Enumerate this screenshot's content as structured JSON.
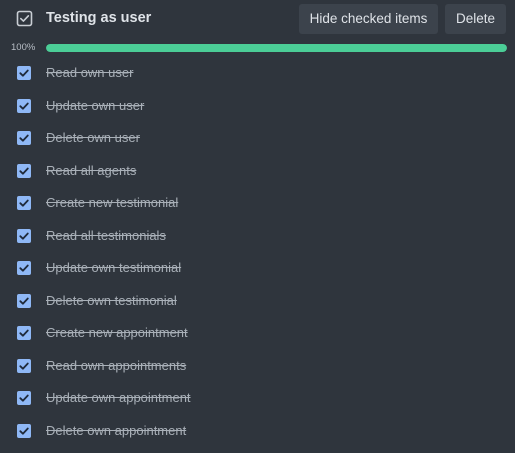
{
  "checklist": {
    "title": "Testing as user",
    "icon": "checkbox-icon",
    "hide_checked_label": "Hide checked items",
    "delete_label": "Delete",
    "progress_text": "100%",
    "progress_fraction": 1.0,
    "progress_color": "#4bce97",
    "check_color": "#8fb8f6",
    "items": [
      {
        "label": "Read own user",
        "checked": true
      },
      {
        "label": "Update own user",
        "checked": true
      },
      {
        "label": "Delete own user",
        "checked": true
      },
      {
        "label": "Read all agents",
        "checked": true
      },
      {
        "label": "Create new testimonial",
        "checked": true
      },
      {
        "label": "Read all testimonials",
        "checked": true
      },
      {
        "label": "Update own testimonial",
        "checked": true
      },
      {
        "label": "Delete own testimonial",
        "checked": true
      },
      {
        "label": "Create new appointment",
        "checked": true
      },
      {
        "label": "Read own appointments",
        "checked": true
      },
      {
        "label": "Update own appointment",
        "checked": true
      },
      {
        "label": "Delete own appointment",
        "checked": true
      }
    ]
  }
}
